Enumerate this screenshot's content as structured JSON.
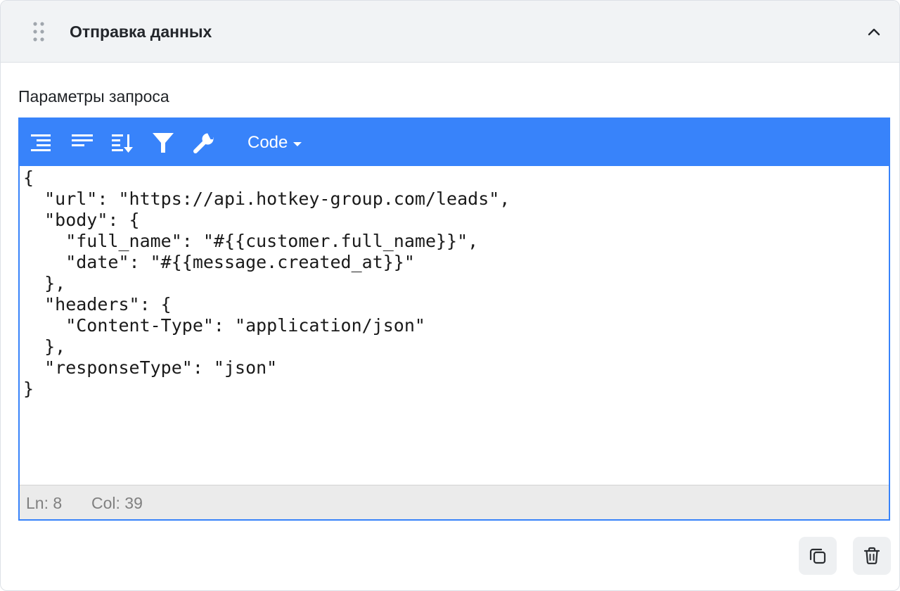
{
  "header": {
    "title": "Отправка данных"
  },
  "section": {
    "label": "Параметры запроса"
  },
  "editor": {
    "mode_label": "Code",
    "code_lines": [
      "{",
      "  \"url\": \"https://api.hotkey-group.com/leads\",",
      "  \"body\": {",
      "    \"full_name\": \"#{{customer.full_name}}\",",
      "    \"date\": \"#{{message.created_at}}\"",
      "  },",
      "  \"headers\": {",
      "    \"Content-Type\": \"application/json\"",
      "  },",
      "  \"responseType\": \"json\"",
      "}"
    ],
    "status": {
      "line": "Ln: 8",
      "column": "Col: 39"
    },
    "toolbar_icons": [
      "format-icon",
      "compact-icon",
      "sort-icon",
      "filter-icon",
      "repair-icon"
    ]
  },
  "actions": {
    "icons": [
      "copy-icon",
      "trash-icon"
    ]
  },
  "colors": {
    "accent": "#3883fa",
    "header_bg": "#f1f3f5",
    "statusbar_bg": "#ebebeb"
  }
}
